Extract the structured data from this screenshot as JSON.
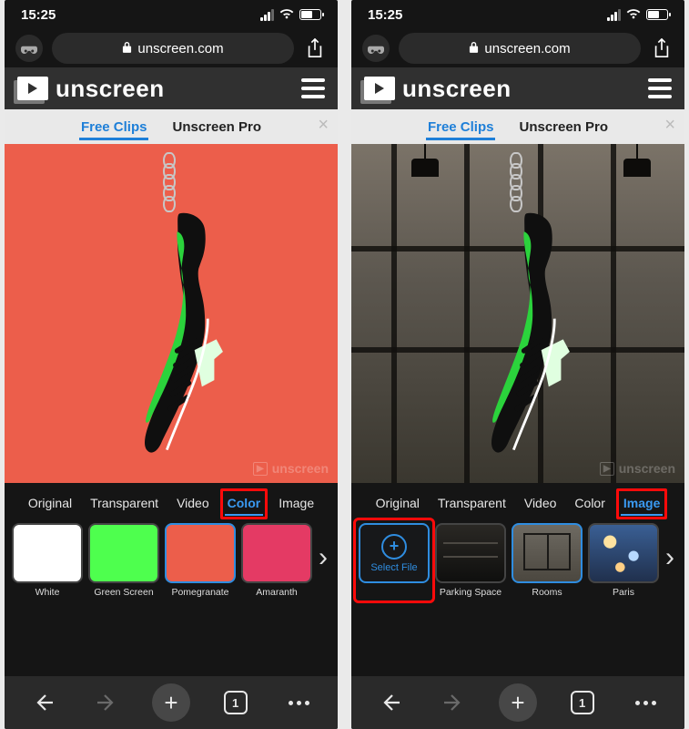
{
  "status": {
    "time": "15:25"
  },
  "browser": {
    "domain": "unscreen.com",
    "tab_count": "1"
  },
  "app": {
    "brand": "unscreen",
    "tabs": {
      "free": "Free Clips",
      "pro": "Unscreen Pro"
    },
    "watermark": "unscreen"
  },
  "bg_tabs": {
    "original": "Original",
    "transparent": "Transparent",
    "video": "Video",
    "color": "Color",
    "image": "Image"
  },
  "left": {
    "selected_bg_tab": "color",
    "colors": {
      "preview": "#ec5e4b",
      "items": [
        {
          "label": "White",
          "hex": "#ffffff"
        },
        {
          "label": "Green Screen",
          "hex": "#4eff4e"
        },
        {
          "label": "Pomegranate",
          "hex": "#ec5e4b",
          "selected": true
        },
        {
          "label": "Amaranth",
          "hex": "#e43a64"
        }
      ]
    }
  },
  "right": {
    "selected_bg_tab": "image",
    "images": {
      "select_file": "Select File",
      "items": [
        {
          "label": "Parking Space"
        },
        {
          "label": "Rooms",
          "selected": true
        },
        {
          "label": "Paris"
        }
      ]
    }
  }
}
